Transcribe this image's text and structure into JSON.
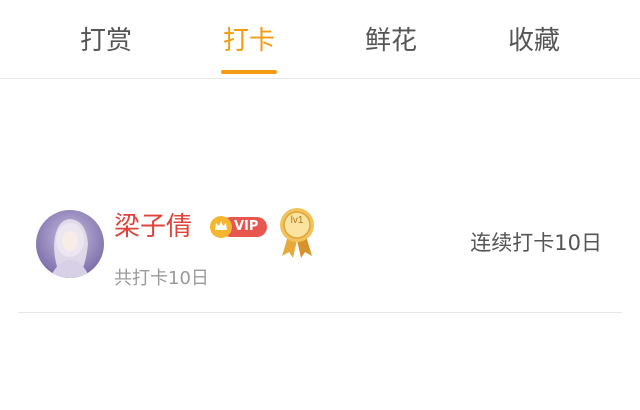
{
  "tabs": [
    {
      "label": "打赏"
    },
    {
      "label": "打卡"
    },
    {
      "label": "鲜花"
    },
    {
      "label": "收藏"
    }
  ],
  "active_tab": "打卡",
  "accent_color": "#f39c12",
  "list": [
    {
      "username": "梁子倩",
      "vip_label": "VIP",
      "level_badge": "lv1",
      "total_checkins": "共打卡10日",
      "streak": "连续打卡10日",
      "avatar_icon": "user-avatar"
    }
  ]
}
